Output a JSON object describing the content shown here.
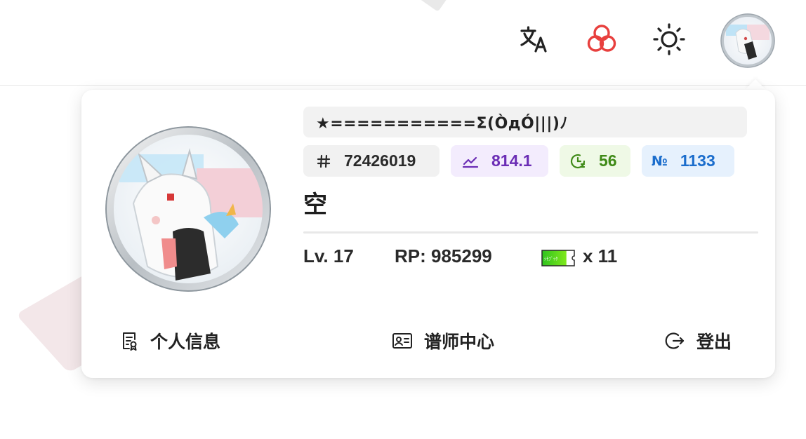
{
  "header": {
    "translate_icon": "translate-icon",
    "theme_color_icon": "color-circles-icon",
    "brightness_icon": "sun-icon",
    "accent_color": "#e8403e"
  },
  "user": {
    "nickname": "★===========Σ(ÒдÓ|||)ﾉ",
    "id": "72426019",
    "rating": "814.1",
    "play_count": "56",
    "rank": "1133",
    "username": "空",
    "level": "Lv. 17",
    "rp": "RP: 985299",
    "tickets": "x 11",
    "ticket_text": "ｼﾓﾌﾞｯｸ"
  },
  "menu": {
    "profile": "个人信息",
    "mapper_center": "谱师中心",
    "logout": "登出"
  },
  "colors": {
    "rating_text": "#6b2db5",
    "play_text": "#3f8a17",
    "rank_text": "#1b6dcc"
  }
}
